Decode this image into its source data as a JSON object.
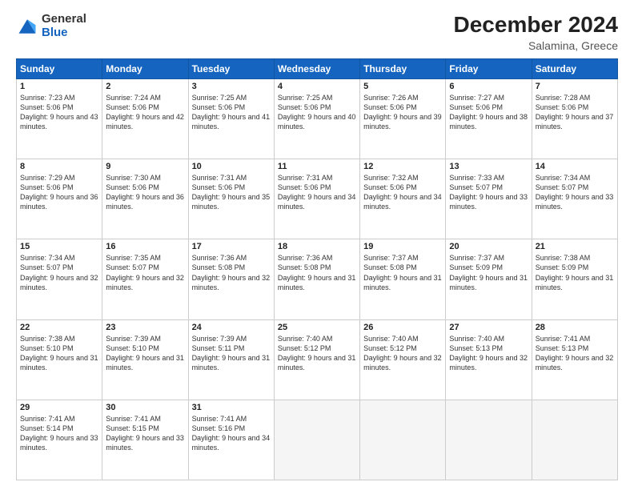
{
  "logo": {
    "general": "General",
    "blue": "Blue"
  },
  "header": {
    "month": "December 2024",
    "location": "Salamina, Greece"
  },
  "weekdays": [
    "Sunday",
    "Monday",
    "Tuesday",
    "Wednesday",
    "Thursday",
    "Friday",
    "Saturday"
  ],
  "weeks": [
    [
      {
        "day": "1",
        "sunrise": "Sunrise: 7:23 AM",
        "sunset": "Sunset: 5:06 PM",
        "daylight": "Daylight: 9 hours and 43 minutes."
      },
      {
        "day": "2",
        "sunrise": "Sunrise: 7:24 AM",
        "sunset": "Sunset: 5:06 PM",
        "daylight": "Daylight: 9 hours and 42 minutes."
      },
      {
        "day": "3",
        "sunrise": "Sunrise: 7:25 AM",
        "sunset": "Sunset: 5:06 PM",
        "daylight": "Daylight: 9 hours and 41 minutes."
      },
      {
        "day": "4",
        "sunrise": "Sunrise: 7:25 AM",
        "sunset": "Sunset: 5:06 PM",
        "daylight": "Daylight: 9 hours and 40 minutes."
      },
      {
        "day": "5",
        "sunrise": "Sunrise: 7:26 AM",
        "sunset": "Sunset: 5:06 PM",
        "daylight": "Daylight: 9 hours and 39 minutes."
      },
      {
        "day": "6",
        "sunrise": "Sunrise: 7:27 AM",
        "sunset": "Sunset: 5:06 PM",
        "daylight": "Daylight: 9 hours and 38 minutes."
      },
      {
        "day": "7",
        "sunrise": "Sunrise: 7:28 AM",
        "sunset": "Sunset: 5:06 PM",
        "daylight": "Daylight: 9 hours and 37 minutes."
      }
    ],
    [
      {
        "day": "8",
        "sunrise": "Sunrise: 7:29 AM",
        "sunset": "Sunset: 5:06 PM",
        "daylight": "Daylight: 9 hours and 36 minutes."
      },
      {
        "day": "9",
        "sunrise": "Sunrise: 7:30 AM",
        "sunset": "Sunset: 5:06 PM",
        "daylight": "Daylight: 9 hours and 36 minutes."
      },
      {
        "day": "10",
        "sunrise": "Sunrise: 7:31 AM",
        "sunset": "Sunset: 5:06 PM",
        "daylight": "Daylight: 9 hours and 35 minutes."
      },
      {
        "day": "11",
        "sunrise": "Sunrise: 7:31 AM",
        "sunset": "Sunset: 5:06 PM",
        "daylight": "Daylight: 9 hours and 34 minutes."
      },
      {
        "day": "12",
        "sunrise": "Sunrise: 7:32 AM",
        "sunset": "Sunset: 5:06 PM",
        "daylight": "Daylight: 9 hours and 34 minutes."
      },
      {
        "day": "13",
        "sunrise": "Sunrise: 7:33 AM",
        "sunset": "Sunset: 5:07 PM",
        "daylight": "Daylight: 9 hours and 33 minutes."
      },
      {
        "day": "14",
        "sunrise": "Sunrise: 7:34 AM",
        "sunset": "Sunset: 5:07 PM",
        "daylight": "Daylight: 9 hours and 33 minutes."
      }
    ],
    [
      {
        "day": "15",
        "sunrise": "Sunrise: 7:34 AM",
        "sunset": "Sunset: 5:07 PM",
        "daylight": "Daylight: 9 hours and 32 minutes."
      },
      {
        "day": "16",
        "sunrise": "Sunrise: 7:35 AM",
        "sunset": "Sunset: 5:07 PM",
        "daylight": "Daylight: 9 hours and 32 minutes."
      },
      {
        "day": "17",
        "sunrise": "Sunrise: 7:36 AM",
        "sunset": "Sunset: 5:08 PM",
        "daylight": "Daylight: 9 hours and 32 minutes."
      },
      {
        "day": "18",
        "sunrise": "Sunrise: 7:36 AM",
        "sunset": "Sunset: 5:08 PM",
        "daylight": "Daylight: 9 hours and 31 minutes."
      },
      {
        "day": "19",
        "sunrise": "Sunrise: 7:37 AM",
        "sunset": "Sunset: 5:08 PM",
        "daylight": "Daylight: 9 hours and 31 minutes."
      },
      {
        "day": "20",
        "sunrise": "Sunrise: 7:37 AM",
        "sunset": "Sunset: 5:09 PM",
        "daylight": "Daylight: 9 hours and 31 minutes."
      },
      {
        "day": "21",
        "sunrise": "Sunrise: 7:38 AM",
        "sunset": "Sunset: 5:09 PM",
        "daylight": "Daylight: 9 hours and 31 minutes."
      }
    ],
    [
      {
        "day": "22",
        "sunrise": "Sunrise: 7:38 AM",
        "sunset": "Sunset: 5:10 PM",
        "daylight": "Daylight: 9 hours and 31 minutes."
      },
      {
        "day": "23",
        "sunrise": "Sunrise: 7:39 AM",
        "sunset": "Sunset: 5:10 PM",
        "daylight": "Daylight: 9 hours and 31 minutes."
      },
      {
        "day": "24",
        "sunrise": "Sunrise: 7:39 AM",
        "sunset": "Sunset: 5:11 PM",
        "daylight": "Daylight: 9 hours and 31 minutes."
      },
      {
        "day": "25",
        "sunrise": "Sunrise: 7:40 AM",
        "sunset": "Sunset: 5:12 PM",
        "daylight": "Daylight: 9 hours and 31 minutes."
      },
      {
        "day": "26",
        "sunrise": "Sunrise: 7:40 AM",
        "sunset": "Sunset: 5:12 PM",
        "daylight": "Daylight: 9 hours and 32 minutes."
      },
      {
        "day": "27",
        "sunrise": "Sunrise: 7:40 AM",
        "sunset": "Sunset: 5:13 PM",
        "daylight": "Daylight: 9 hours and 32 minutes."
      },
      {
        "day": "28",
        "sunrise": "Sunrise: 7:41 AM",
        "sunset": "Sunset: 5:13 PM",
        "daylight": "Daylight: 9 hours and 32 minutes."
      }
    ],
    [
      {
        "day": "29",
        "sunrise": "Sunrise: 7:41 AM",
        "sunset": "Sunset: 5:14 PM",
        "daylight": "Daylight: 9 hours and 33 minutes."
      },
      {
        "day": "30",
        "sunrise": "Sunrise: 7:41 AM",
        "sunset": "Sunset: 5:15 PM",
        "daylight": "Daylight: 9 hours and 33 minutes."
      },
      {
        "day": "31",
        "sunrise": "Sunrise: 7:41 AM",
        "sunset": "Sunset: 5:16 PM",
        "daylight": "Daylight: 9 hours and 34 minutes."
      },
      null,
      null,
      null,
      null
    ]
  ]
}
